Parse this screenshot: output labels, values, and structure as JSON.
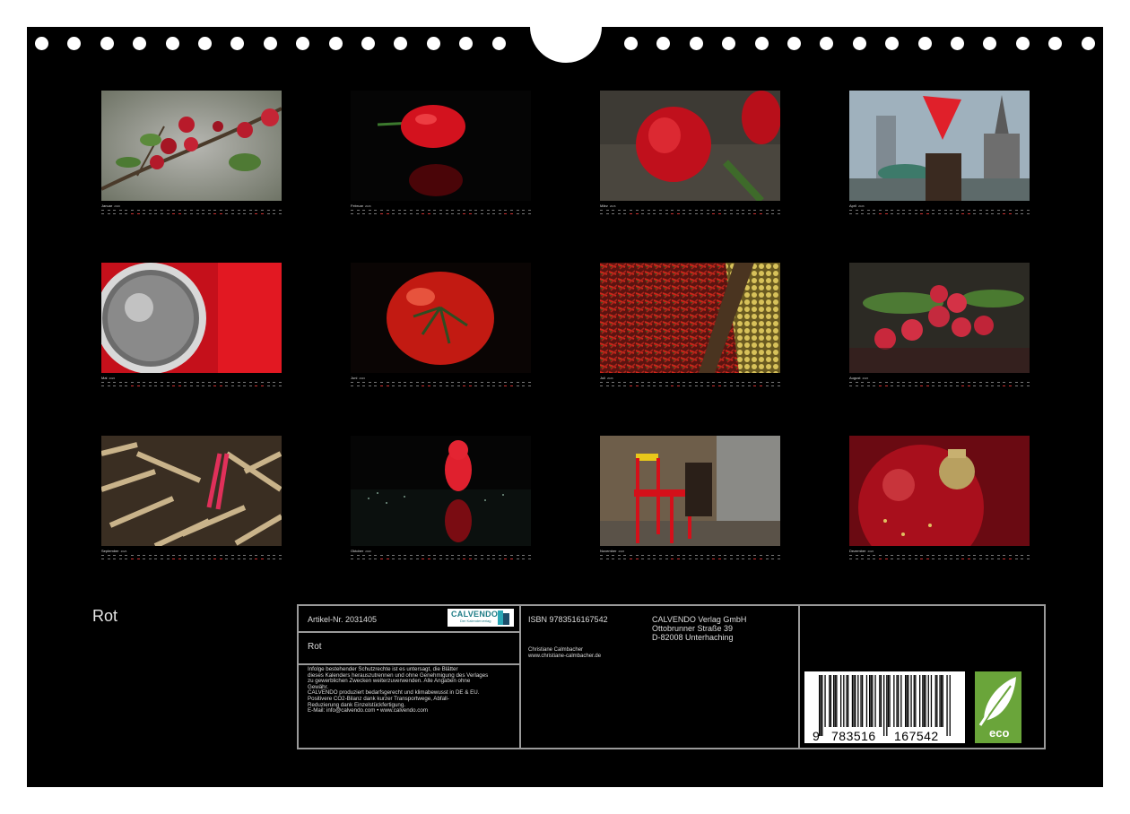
{
  "calendar": {
    "title": "Rot",
    "months": [
      {
        "name": "Januar",
        "year": "2026"
      },
      {
        "name": "Februar",
        "year": "2026"
      },
      {
        "name": "März",
        "year": "2026"
      },
      {
        "name": "April",
        "year": "2026"
      },
      {
        "name": "Mai",
        "year": "2026"
      },
      {
        "name": "Juni",
        "year": "2026"
      },
      {
        "name": "Juli",
        "year": "2026"
      },
      {
        "name": "August",
        "year": "2026"
      },
      {
        "name": "September",
        "year": "2026"
      },
      {
        "name": "Oktober",
        "year": "2026"
      },
      {
        "name": "November",
        "year": "2026"
      },
      {
        "name": "Dezember",
        "year": "2026"
      }
    ]
  },
  "info": {
    "article_no": "Artikel-Nr. 2031405",
    "logo_text": "CALVENDO",
    "logo_sub": "Der Kalenderverlag",
    "product_title": "Rot",
    "legal_lines": [
      "Infolge bestehender Schutzrechte ist es untersagt, die Blätter",
      "dieses Kalenders herauszutrennen und ohne Genehmigung des Verlages",
      "zu gewerblichen Zwecken weiterzuverwenden. Alle Angaben ohne",
      "Gewähr.",
      "CALVENDO produziert bedarfsgerecht und klimabewusst in DE & EU.",
      "Positivere CO2-Bilanz dank kurzer Transportwege, Abfall-",
      "Reduzierung dank Einzelstückfertigung.",
      "E-Mail: info@calvendo.com • www.calvendo.com"
    ],
    "isbn": "ISBN 9783516167542",
    "author": "Christiane Calmbacher",
    "author_url": "www.christiane-calmbacher.de",
    "publisher": "CALVENDO Verlag GmbH",
    "street": "Ottobrunner Straße 39",
    "city": "D-82008 Unterhaching",
    "barcode_digits": [
      "9",
      "783516",
      "167542"
    ],
    "eco_label": "eco"
  },
  "colors": {
    "background": "#000000",
    "accent_red": "#c8101c",
    "border": "#9a9a9a",
    "logo_teal": "#1e7c86",
    "eco_green": "#6aa53a"
  }
}
